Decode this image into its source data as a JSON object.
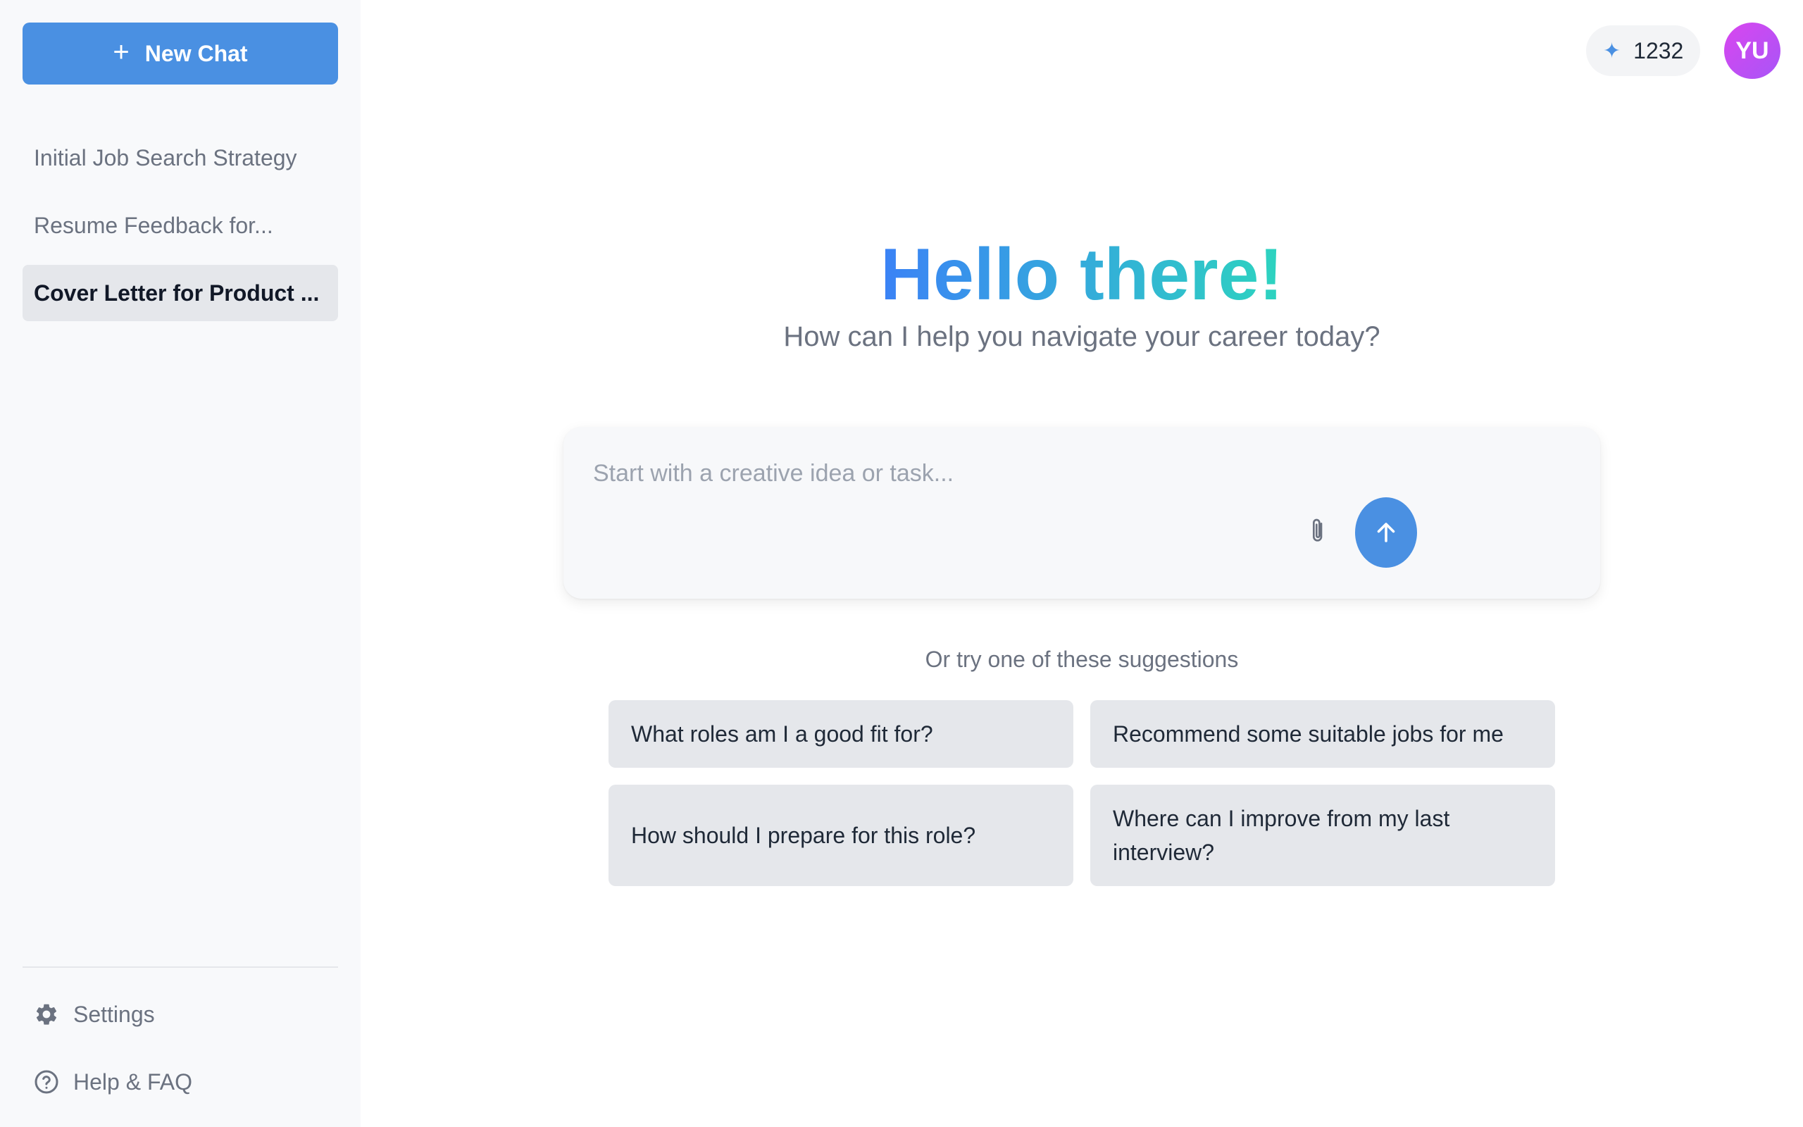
{
  "sidebar": {
    "new_chat_label": "New Chat",
    "history": [
      {
        "label": "Initial Job Search Strategy",
        "active": false
      },
      {
        "label": "Resume Feedback for...",
        "active": false
      },
      {
        "label": "Cover Letter for Product ...",
        "active": true
      }
    ],
    "footer": {
      "settings_label": "Settings",
      "help_label": "Help & FAQ"
    }
  },
  "header": {
    "credits": "1232",
    "credits_icon": "sparkle-icon",
    "avatar_initials": "YU"
  },
  "hero": {
    "title": "Hello there!",
    "subtitle": "How can I help you navigate your career today?"
  },
  "composer": {
    "placeholder": "Start with a creative idea or task...",
    "value": "",
    "attach_icon": "paperclip-icon",
    "send_icon": "arrow-up-icon"
  },
  "suggestions": {
    "label": "Or try one of these suggestions",
    "items": [
      "What roles am I a good fit for?",
      "Recommend some suitable jobs for me",
      "How should I prepare for this role?",
      "Where can I improve from my last interview?"
    ]
  },
  "colors": {
    "accent": "#4a90e2",
    "sidebar_bg": "#f8f9fb",
    "chip_bg": "#e5e7eb",
    "title_gradient_start": "#3b82f6",
    "title_gradient_end": "#2dd4bf",
    "avatar": "#c846e6"
  }
}
